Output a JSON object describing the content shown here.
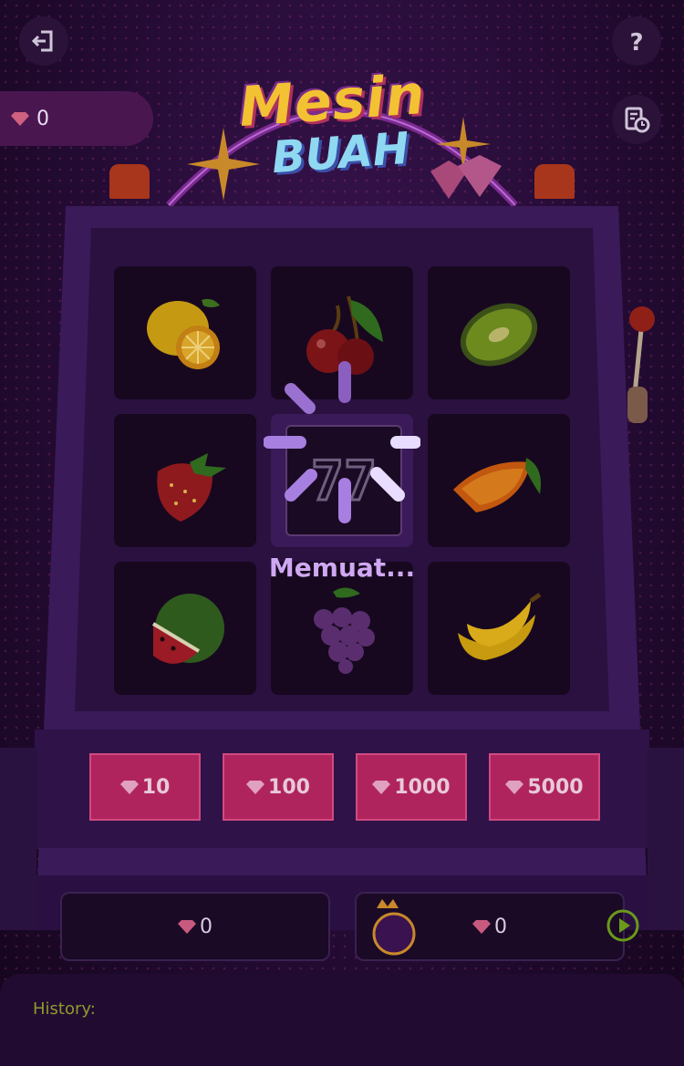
{
  "title": {
    "line1": "Mesin",
    "line2": "BUAH"
  },
  "balance": {
    "value": "0"
  },
  "icons": {
    "exit": "exit-icon",
    "help": "question-icon",
    "records": "records-icon",
    "gem": "gem-icon",
    "play": "play-icon"
  },
  "reels": [
    "lemon",
    "cherry",
    "kiwi",
    "strawberry",
    "seven",
    "orange",
    "watermelon",
    "grape",
    "banana"
  ],
  "bets": [
    {
      "label": "10"
    },
    {
      "label": "100"
    },
    {
      "label": "1000"
    },
    {
      "label": "5000"
    }
  ],
  "win_panel": {
    "value": "0"
  },
  "jackpot_panel": {
    "value": "0"
  },
  "loading": {
    "text": "Memuat..."
  },
  "history": {
    "label": "History:"
  },
  "colors": {
    "accent": "#b0245e",
    "loader": "#a77fe0",
    "history_label": "#8f9a2d"
  }
}
